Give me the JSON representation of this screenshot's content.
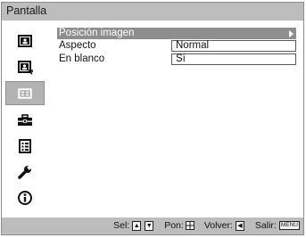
{
  "header": {
    "title": "Pantalla"
  },
  "sidebar": {
    "items": [
      {
        "icon": "picture-icon"
      },
      {
        "icon": "advanced-picture-icon"
      },
      {
        "icon": "screen-icon",
        "active": true
      },
      {
        "icon": "setup-icon"
      },
      {
        "icon": "menu-list-icon"
      },
      {
        "icon": "wrench-icon"
      },
      {
        "icon": "info-icon"
      }
    ]
  },
  "menu": {
    "items": [
      {
        "label": "Posición imagen",
        "value": ""
      },
      {
        "label": "Aspecto",
        "value": "Normal"
      },
      {
        "label": "En blanco",
        "value": "Sí"
      }
    ]
  },
  "footer": {
    "sel_label": "Sel:",
    "pon_label": "Pon:",
    "volver_label": "Volver:",
    "salir_label": "Salir:",
    "menu_key": "MENU"
  },
  "colors": {
    "titlebar": "#bdbdbd",
    "highlight": "#8e8e8e",
    "active_tab": "#b3b3b3"
  }
}
